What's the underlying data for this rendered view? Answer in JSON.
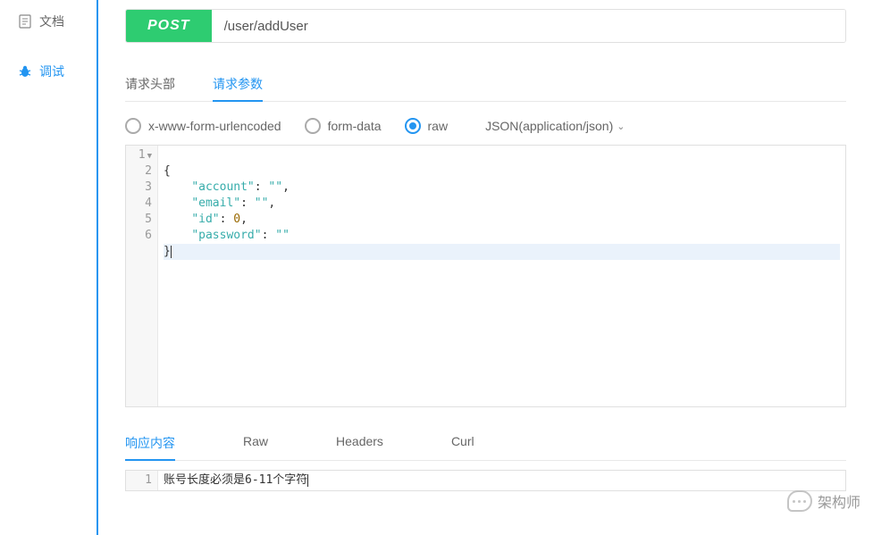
{
  "sidebar": {
    "items": [
      {
        "label": "文档",
        "icon": "document-icon",
        "active": false
      },
      {
        "label": "调试",
        "icon": "bug-icon",
        "active": true
      }
    ]
  },
  "request": {
    "method": "POST",
    "url": "/user/addUser"
  },
  "tabs": {
    "headers": "请求头部",
    "params": "请求参数"
  },
  "bodyTypes": {
    "urlencoded": "x-www-form-urlencoded",
    "formdata": "form-data",
    "raw": "raw",
    "contentType": "JSON(application/json)"
  },
  "codeLines": {
    "l1": "{",
    "l2_key": "\"account\"",
    "l2_val": "\"\"",
    "l3_key": "\"email\"",
    "l3_val": "\"\"",
    "l4_key": "\"id\"",
    "l4_val": "0",
    "l5_key": "\"password\"",
    "l5_val": "\"\"",
    "l6": "}"
  },
  "gutter": {
    "n1": "1",
    "n2": "2",
    "n3": "3",
    "n4": "4",
    "n5": "5",
    "n6": "6"
  },
  "respTabs": {
    "content": "响应内容",
    "raw": "Raw",
    "headers": "Headers",
    "curl": "Curl"
  },
  "response": {
    "line1_num": "1",
    "line1_text": "账号长度必须是6-11个字符"
  },
  "watermark": "架构师"
}
